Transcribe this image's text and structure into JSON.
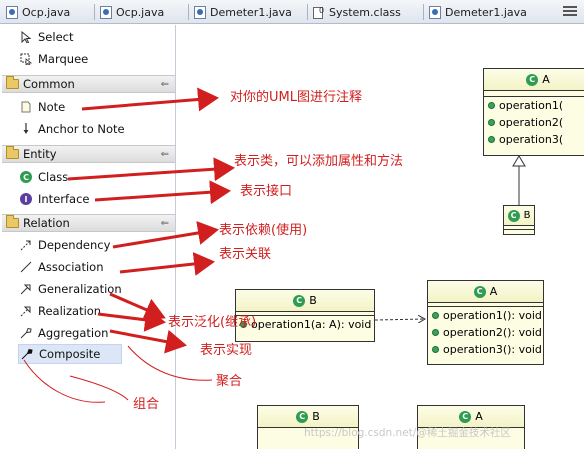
{
  "tabs": [
    {
      "label": "Ocp.java",
      "icon": "java-file-icon"
    },
    {
      "label": "Ocp.java",
      "icon": "java-file-icon"
    },
    {
      "label": "Demeter1.java",
      "icon": "java-file-icon"
    },
    {
      "label": "System.class",
      "icon": "class-file-icon"
    },
    {
      "label": "Demeter1.java",
      "icon": "java-file-icon"
    }
  ],
  "palette": {
    "tools": [
      {
        "label": "Select",
        "icon": "select-arrow-icon"
      },
      {
        "label": "Marquee",
        "icon": "marquee-icon"
      }
    ],
    "drawers": [
      {
        "label": "Common",
        "items": [
          {
            "label": "Note",
            "icon": "note-icon"
          },
          {
            "label": "Anchor to Note",
            "icon": "anchor-icon"
          }
        ]
      },
      {
        "label": "Entity",
        "items": [
          {
            "label": "Class",
            "icon": "class-icon"
          },
          {
            "label": "Interface",
            "icon": "interface-icon"
          }
        ]
      },
      {
        "label": "Relation",
        "items": [
          {
            "label": "Dependency",
            "icon": "dependency-icon"
          },
          {
            "label": "Association",
            "icon": "association-icon"
          },
          {
            "label": "Generalization",
            "icon": "generalization-icon"
          },
          {
            "label": "Realization",
            "icon": "realization-icon"
          },
          {
            "label": "Aggregation",
            "icon": "aggregation-icon"
          },
          {
            "label": "Composite",
            "icon": "composite-icon",
            "selected": true
          }
        ]
      }
    ]
  },
  "diagram": {
    "class_a_top": {
      "name": "A",
      "operations": [
        "operation1(",
        "operation2(",
        "operation3("
      ]
    },
    "class_b_top": {
      "name": "B"
    },
    "class_b_mid": {
      "name": "B",
      "operations": [
        "operation1(a: A): void"
      ]
    },
    "class_a_mid": {
      "name": "A",
      "operations": [
        "operation1(): void",
        "operation2(): void",
        "operation3(): void"
      ]
    },
    "class_b_bottom": {
      "name": "B"
    },
    "class_a_bottom": {
      "name": "A"
    }
  },
  "annotations": {
    "note": "对你的UML图进行注释",
    "class": "表示类，可以添加属性和方法",
    "interface": "表示接口",
    "dependency": "表示依赖(使用)",
    "association": "表示关联",
    "generalization": "表示泛化(继承)",
    "realization": "表示实现",
    "aggregation": "聚合",
    "composite": "组合"
  },
  "watermark": "https://blog.csdn.net/@稀土掘金技术社区",
  "colors": {
    "annotation": "#d11e1e",
    "uml_fill": "#fdfde4",
    "class_icon": "#2f9c52",
    "selection": "#dde6f6"
  }
}
